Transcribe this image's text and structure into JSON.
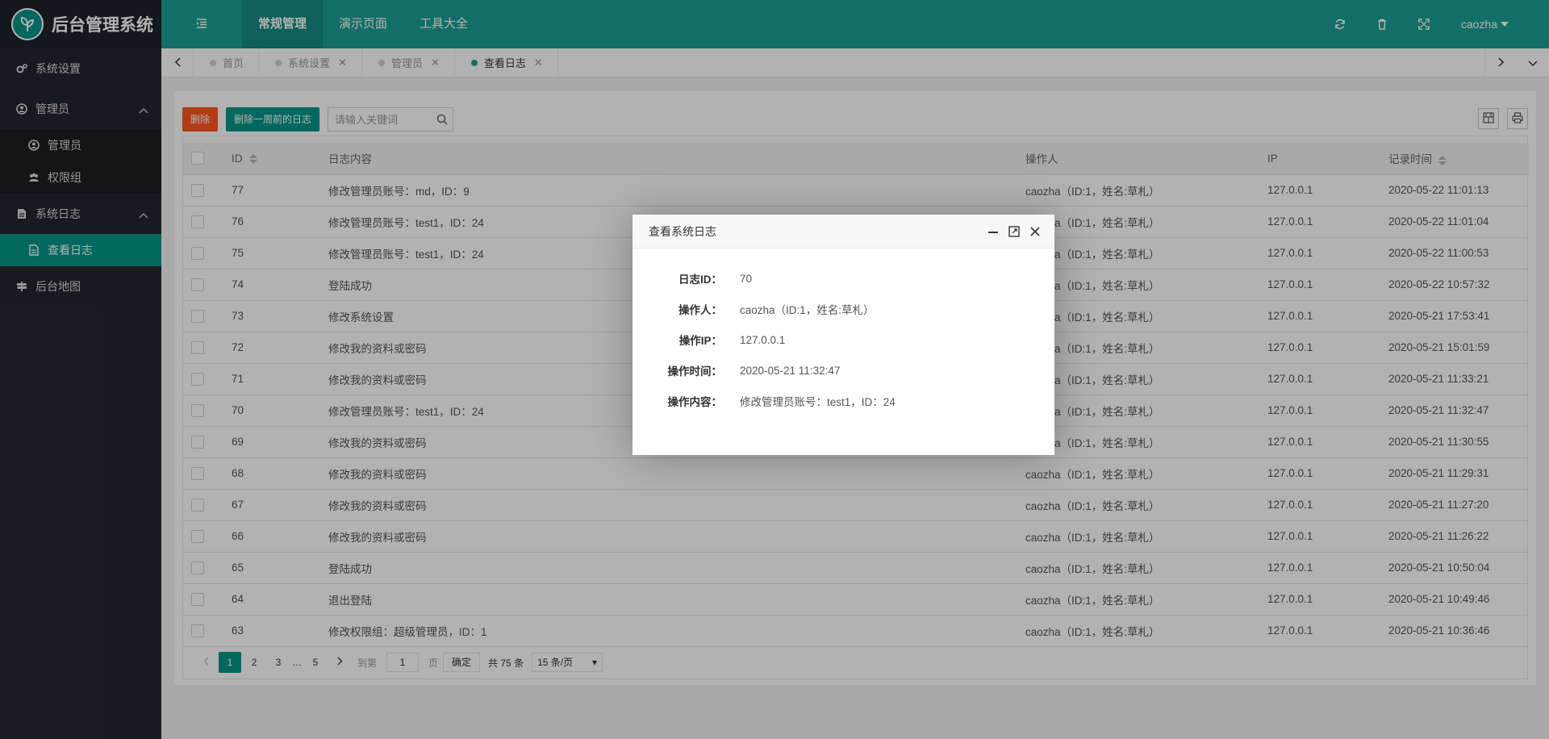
{
  "app": {
    "title": "后台管理系统"
  },
  "sidebar": {
    "items": [
      {
        "label": "系统设置"
      },
      {
        "label": "管理员"
      },
      {
        "label": "管理员"
      },
      {
        "label": "权限组"
      },
      {
        "label": "系统日志"
      },
      {
        "label": "查看日志"
      },
      {
        "label": "后台地图"
      }
    ]
  },
  "header": {
    "nav": [
      {
        "label": "常规管理"
      },
      {
        "label": "演示页面"
      },
      {
        "label": "工具大全"
      }
    ],
    "user": "caozha"
  },
  "tabs": [
    {
      "label": "首页"
    },
    {
      "label": "系统设置"
    },
    {
      "label": "管理员"
    },
    {
      "label": "查看日志"
    }
  ],
  "toolbar": {
    "delete_label": "删除",
    "delete_old_label": "删除一周前的日志",
    "search_placeholder": "请输入关键词"
  },
  "table": {
    "columns": {
      "id": "ID",
      "content": "日志内容",
      "operator": "操作人",
      "ip": "IP",
      "time": "记录时间"
    },
    "rows": [
      {
        "id": "77",
        "content": "修改管理员账号：md，ID：9",
        "operator": "caozha（ID:1，姓名:草札）",
        "ip": "127.0.0.1",
        "time": "2020-05-22 11:01:13"
      },
      {
        "id": "76",
        "content": "修改管理员账号：test1，ID：24",
        "operator": "caozha（ID:1，姓名:草札）",
        "ip": "127.0.0.1",
        "time": "2020-05-22 11:01:04"
      },
      {
        "id": "75",
        "content": "修改管理员账号：test1，ID：24",
        "operator": "caozha（ID:1，姓名:草札）",
        "ip": "127.0.0.1",
        "time": "2020-05-22 11:00:53"
      },
      {
        "id": "74",
        "content": "登陆成功",
        "operator": "caozha（ID:1，姓名:草札）",
        "ip": "127.0.0.1",
        "time": "2020-05-22 10:57:32"
      },
      {
        "id": "73",
        "content": "修改系统设置",
        "operator": "caozha（ID:1，姓名:草札）",
        "ip": "127.0.0.1",
        "time": "2020-05-21 17:53:41"
      },
      {
        "id": "72",
        "content": "修改我的资料或密码",
        "operator": "caozha（ID:1，姓名:草札）",
        "ip": "127.0.0.1",
        "time": "2020-05-21 15:01:59"
      },
      {
        "id": "71",
        "content": "修改我的资料或密码",
        "operator": "caozha（ID:1，姓名:草札）",
        "ip": "127.0.0.1",
        "time": "2020-05-21 11:33:21"
      },
      {
        "id": "70",
        "content": "修改管理员账号：test1，ID：24",
        "operator": "caozha（ID:1，姓名:草札）",
        "ip": "127.0.0.1",
        "time": "2020-05-21 11:32:47"
      },
      {
        "id": "69",
        "content": "修改我的资料或密码",
        "operator": "caozha（ID:1，姓名:草札）",
        "ip": "127.0.0.1",
        "time": "2020-05-21 11:30:55"
      },
      {
        "id": "68",
        "content": "修改我的资料或密码",
        "operator": "caozha（ID:1，姓名:草札）",
        "ip": "127.0.0.1",
        "time": "2020-05-21 11:29:31"
      },
      {
        "id": "67",
        "content": "修改我的资料或密码",
        "operator": "caozha（ID:1，姓名:草札）",
        "ip": "127.0.0.1",
        "time": "2020-05-21 11:27:20"
      },
      {
        "id": "66",
        "content": "修改我的资料或密码",
        "operator": "caozha（ID:1，姓名:草札）",
        "ip": "127.0.0.1",
        "time": "2020-05-21 11:26:22"
      },
      {
        "id": "65",
        "content": "登陆成功",
        "operator": "caozha（ID:1，姓名:草札）",
        "ip": "127.0.0.1",
        "time": "2020-05-21 10:50:04"
      },
      {
        "id": "64",
        "content": "退出登陆",
        "operator": "caozha（ID:1，姓名:草札）",
        "ip": "127.0.0.1",
        "time": "2020-05-21 10:49:46"
      },
      {
        "id": "63",
        "content": "修改权限组：超级管理员，ID：1",
        "operator": "caozha（ID:1，姓名:草札）",
        "ip": "127.0.0.1",
        "time": "2020-05-21 10:36:46"
      }
    ]
  },
  "pager": {
    "pages": [
      "1",
      "2",
      "3",
      "…",
      "5"
    ],
    "goto_label": "到第",
    "goto_value": "1",
    "page_unit": "页",
    "confirm": "确定",
    "total": "共 75 条",
    "per_page": "15 条/页"
  },
  "modal": {
    "title": "查看系统日志",
    "fields": [
      {
        "label": "日志ID：",
        "value": "70"
      },
      {
        "label": "操作人：",
        "value": "caozha（ID:1，姓名:草札）"
      },
      {
        "label": "操作IP：",
        "value": "127.0.0.1"
      },
      {
        "label": "操作时间：",
        "value": "2020-05-21 11:32:47"
      },
      {
        "label": "操作内容：",
        "value": "修改管理员账号：test1，ID：24"
      }
    ]
  },
  "colors": {
    "primary": "#009688",
    "header": "#1aa094",
    "danger": "#ff5722",
    "sidebar": "#23262e"
  }
}
